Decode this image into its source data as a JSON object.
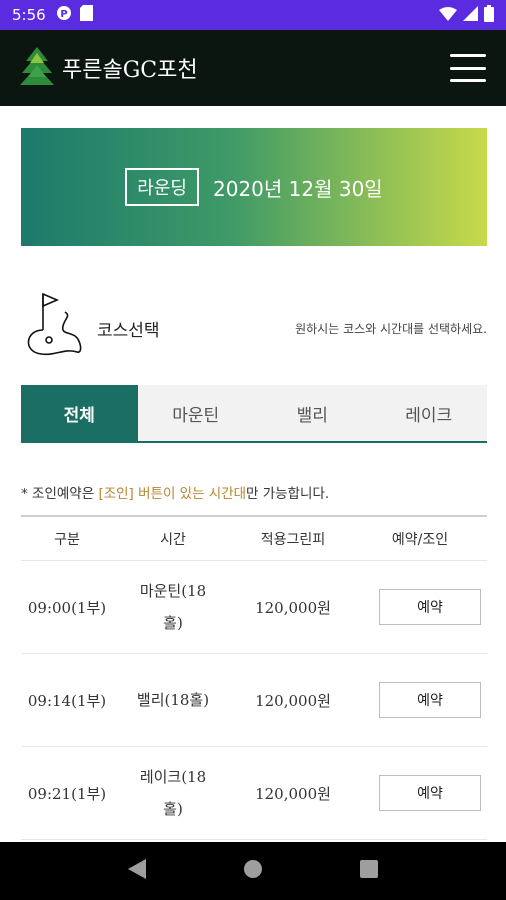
{
  "status_bar": {
    "time": "5:56",
    "icons": [
      "notification-p-icon",
      "sd-card-icon",
      "wifi-icon",
      "signal-icon",
      "battery-icon"
    ]
  },
  "header": {
    "brand": "푸른솔GC포천",
    "menu_icon": "hamburger-menu-icon"
  },
  "banner": {
    "badge": "라운딩",
    "date": "2020년 12월 30일"
  },
  "course_select": {
    "title": "코스선택",
    "description": "원하시는 코스와 시간대를 선택하세요."
  },
  "tabs": [
    {
      "label": "전체",
      "active": true
    },
    {
      "label": "마운틴",
      "active": false
    },
    {
      "label": "밸리",
      "active": false
    },
    {
      "label": "레이크",
      "active": false
    }
  ],
  "notice": {
    "prefix": "* 조인예약은 ",
    "highlight": "[조인] 버튼이 있는 시간대",
    "suffix": "만 가능합니다."
  },
  "table": {
    "headers": [
      "구분",
      "시간",
      "적용그린피",
      "예약/조인"
    ],
    "rows": [
      {
        "time": "09:00(1부)",
        "course": "마운틴(18홀)",
        "fee": "120,000원",
        "action": "예약"
      },
      {
        "time": "09:14(1부)",
        "course": "밸리(18홀)",
        "fee": "120,000원",
        "action": "예약"
      },
      {
        "time": "09:21(1부)",
        "course": "레이크(18홀)",
        "fee": "120,000원",
        "action": "예약"
      }
    ]
  },
  "colors": {
    "status_bar": "#5b2be0",
    "header_bg": "#0b1611",
    "accent": "#1a6e63",
    "highlight": "#b8862f"
  }
}
